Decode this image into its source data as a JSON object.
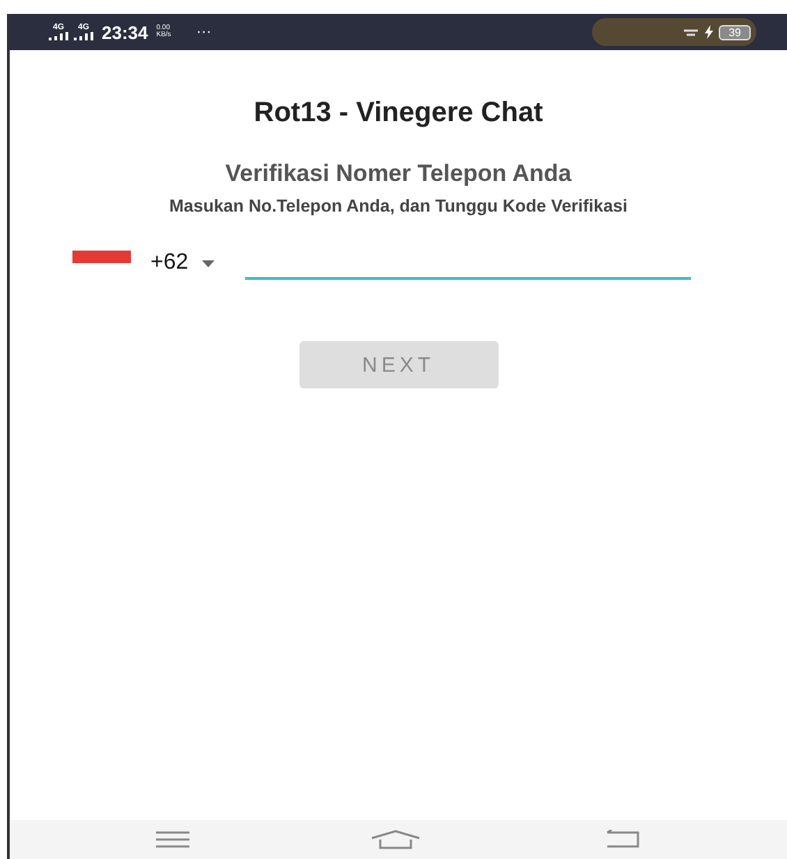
{
  "status_bar": {
    "networks": [
      "4G",
      "4G"
    ],
    "time": "23:34",
    "speed_value": "0.00",
    "speed_unit": "KB/s",
    "more": "···",
    "battery": "39"
  },
  "title": "Rot13 - Vinegere Chat",
  "subtitle": "Verifikasi Nomer Telepon Anda",
  "instruction": "Masukan No.Telepon Anda, dan Tunggu Kode Verifikasi",
  "phone_form": {
    "country_code": "+62"
  },
  "buttons": [
    {
      "label": "NEXT",
      "disabled": true
    }
  ]
}
